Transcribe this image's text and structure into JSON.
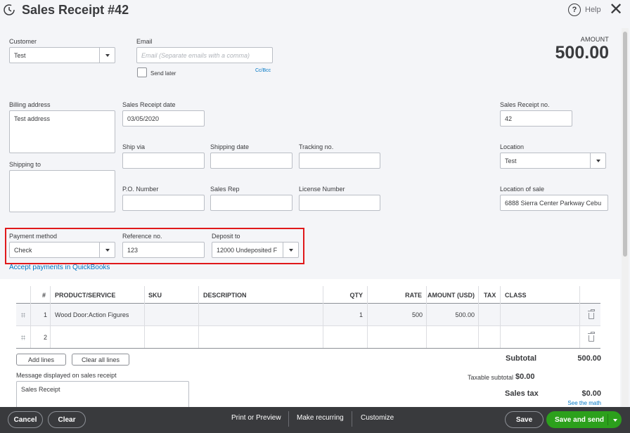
{
  "header": {
    "title": "Sales Receipt #42",
    "help_label": "Help",
    "help_glyph": "?",
    "close_glyph": "✕"
  },
  "amount": {
    "label": "AMOUNT",
    "value": "500.00"
  },
  "customer": {
    "label": "Customer",
    "value": "Test"
  },
  "email": {
    "label": "Email",
    "placeholder": "Email (Separate emails with a comma)",
    "send_later": "Send later",
    "cc_bcc": "Cc/Bcc"
  },
  "billing": {
    "label": "Billing address",
    "value": "Test address"
  },
  "shipping_to": {
    "label": "Shipping to",
    "value": ""
  },
  "receipt_date": {
    "label": "Sales Receipt date",
    "value": "03/05/2020"
  },
  "receipt_no": {
    "label": "Sales Receipt no.",
    "value": "42"
  },
  "ship_via": {
    "label": "Ship via",
    "value": ""
  },
  "shipping_date": {
    "label": "Shipping date",
    "value": ""
  },
  "tracking_no": {
    "label": "Tracking no.",
    "value": ""
  },
  "location": {
    "label": "Location",
    "value": "Test"
  },
  "po_number": {
    "label": "P.O. Number",
    "value": ""
  },
  "sales_rep": {
    "label": "Sales Rep",
    "value": ""
  },
  "license_number": {
    "label": "License Number",
    "value": ""
  },
  "location_of_sale": {
    "label": "Location of sale",
    "value": "6888 Sierra Center Parkway Cebu"
  },
  "payment_method": {
    "label": "Payment method",
    "value": "Check"
  },
  "reference_no": {
    "label": "Reference no.",
    "value": "123"
  },
  "deposit_to": {
    "label": "Deposit to",
    "value": "12000 Undeposited F"
  },
  "accept_payments": "Accept payments in QuickBooks",
  "table": {
    "headers": {
      "num": "#",
      "product": "PRODUCT/SERVICE",
      "sku": "SKU",
      "description": "DESCRIPTION",
      "qty": "QTY",
      "rate": "RATE",
      "amount": "AMOUNT (USD)",
      "tax": "TAX",
      "class": "CLASS"
    },
    "rows": [
      {
        "num": "1",
        "product": "Wood Door:Action Figures",
        "sku": "",
        "description": "",
        "qty": "1",
        "rate": "500",
        "amount": "500.00",
        "tax": "",
        "class": ""
      },
      {
        "num": "2",
        "product": "",
        "sku": "",
        "description": "",
        "qty": "",
        "rate": "",
        "amount": "",
        "tax": "",
        "class": ""
      }
    ]
  },
  "add_lines": "Add lines",
  "clear_all_lines": "Clear all lines",
  "message": {
    "label": "Message displayed on sales receipt",
    "value": "Sales Receipt"
  },
  "totals": {
    "subtotal_label": "Subtotal",
    "subtotal_value": "500.00",
    "taxable_label": "Taxable subtotal",
    "taxable_value": "$0.00",
    "sales_tax_label": "Sales tax",
    "sales_tax_value": "$0.00",
    "see_math": "See the math"
  },
  "footer": {
    "cancel": "Cancel",
    "clear": "Clear",
    "print_preview": "Print or Preview",
    "make_recurring": "Make recurring",
    "customize": "Customize",
    "save": "Save",
    "save_send": "Save and send"
  },
  "colors": {
    "highlight": "#e0191b",
    "green": "#2ca01c",
    "link": "#0077c5",
    "footer_bg": "#393a3d"
  }
}
